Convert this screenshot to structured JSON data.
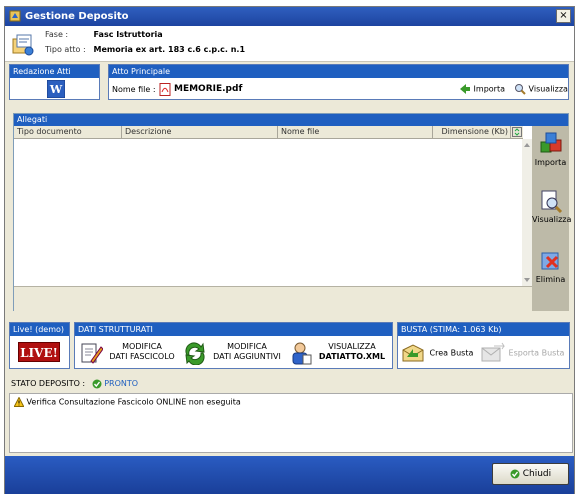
{
  "window": {
    "title": "Gestione Deposito",
    "close_glyph": "×"
  },
  "header": {
    "fase_label": "Fase :",
    "fase_value": "Fasc Istruttoria",
    "tipo_label": "Tipo atto :",
    "tipo_value": "Memoria ex art. 183 c.6 c.p.c. n.1"
  },
  "redazione": {
    "title": "Redazione Atti"
  },
  "atto_principale": {
    "title": "Atto Principale",
    "file_label": "Nome file :",
    "file_name": "MEMORIE.pdf",
    "import_label": "Importa",
    "view_label": "Visualizza"
  },
  "allegati": {
    "title": "Allegati",
    "columns": [
      "Tipo documento",
      "Descrizione",
      "Nome file",
      "Dimensione (Kb)"
    ],
    "rows": []
  },
  "side_actions": {
    "import_label": "Importa",
    "view_label": "Visualizza",
    "delete_label": "Elimina"
  },
  "live": {
    "title": "Live! (demo)",
    "badge": "LIVE!"
  },
  "dati": {
    "title": "DATI STRUTTURATI",
    "modifica_fascicolo": [
      "MODIFICA",
      "DATI FASCICOLO"
    ],
    "modifica_aggiuntivi": [
      "MODIFICA",
      "DATI AGGIUNTIVI"
    ],
    "visualizza_xml": [
      "VISUALIZZA",
      "DATIATTO.XML"
    ]
  },
  "busta": {
    "title": "BUSTA (STIMA: 1.063 Kb)",
    "crea_label": "Crea Busta",
    "esporta_label": "Esporta Busta"
  },
  "stato": {
    "label": "STATO DEPOSITO :",
    "value": "PRONTO"
  },
  "messages": [
    "Verifica Consultazione Fascicolo ONLINE non eseguita"
  ],
  "footer": {
    "close_label": "Chiudi"
  },
  "colors": {
    "title_blue": "#1f5fc0",
    "footer_blue": "#1a3f99",
    "ok_green": "#3a9a2a",
    "live_red": "#b01010"
  }
}
